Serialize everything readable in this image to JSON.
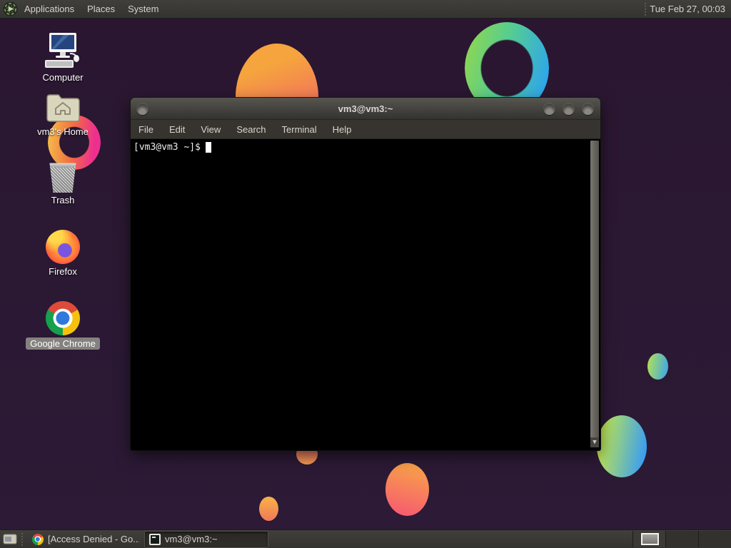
{
  "colors": {
    "desktop_bg": "#2a1630",
    "panel_bg": "#3a3936",
    "panel_text": "#d6d3cd",
    "titlebar_text": "#d8d5cf",
    "terminal_bg": "#000000",
    "terminal_text": "#efedea",
    "selection_chip": "#8c8b85",
    "chrome_blue": "#3079dc",
    "blob_orange": "#f5a43e",
    "blob_pink": "#f2516f",
    "blob_green": "#8fd74f",
    "blob_blue": "#2ea6ea"
  },
  "top_panel": {
    "logo_icon": "distro-logo-icon",
    "menus": [
      {
        "label": "Applications"
      },
      {
        "label": "Places"
      },
      {
        "label": "System"
      }
    ],
    "clock": "Tue Feb 27, 00:03"
  },
  "desktop": {
    "icons": [
      {
        "label": "Computer",
        "icon": "computer-icon"
      },
      {
        "label": "vm3's Home",
        "icon": "home-folder-icon"
      },
      {
        "label": "Trash",
        "icon": "trash-icon"
      },
      {
        "label": "Firefox",
        "icon": "firefox-icon"
      },
      {
        "label": "Google Chrome",
        "icon": "chrome-icon",
        "selected": true
      }
    ]
  },
  "terminal": {
    "title": "vm3@vm3:~",
    "menu_items": [
      "File",
      "Edit",
      "View",
      "Search",
      "Terminal",
      "Help"
    ],
    "prompt": "[vm3@vm3 ~]$",
    "cursor": "block",
    "scroll_down_glyph": "▼"
  },
  "taskbar": {
    "show_desktop_icon": "show-desktop-icon",
    "tasks": [
      {
        "label": "[Access Denied - Go...",
        "icon": "chrome-icon",
        "active": false
      },
      {
        "label": "vm3@vm3:~",
        "icon": "terminal-icon",
        "active": true
      }
    ],
    "workspaces": {
      "count": 3,
      "active_index": 0
    }
  }
}
